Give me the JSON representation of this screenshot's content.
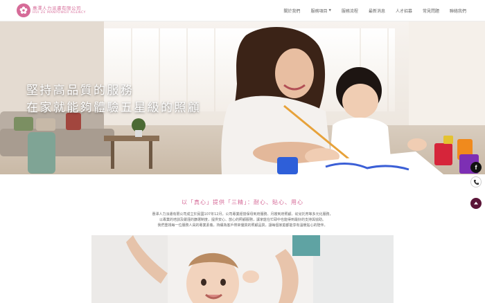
{
  "header": {
    "company_name": "惠澤人力派遣有限公司",
    "company_sub": "HUI ZE MANPOWER AGENCY",
    "logo_icon": "flower-logo-icon",
    "nav": [
      {
        "label": "關於我們",
        "dropdown": false
      },
      {
        "label": "服務項目",
        "dropdown": true
      },
      {
        "label": "服務流程",
        "dropdown": false
      },
      {
        "label": "最新消息",
        "dropdown": false
      },
      {
        "label": "人才招募",
        "dropdown": false
      },
      {
        "label": "常見問題",
        "dropdown": false
      },
      {
        "label": "聯絡我們",
        "dropdown": false
      }
    ]
  },
  "hero": {
    "line1": "堅持高品質的服務",
    "line2": "在家就能夠體驗五星級的照顧"
  },
  "side_buttons": {
    "facebook_label": "f",
    "icons": [
      "facebook-icon",
      "phone-icon",
      "arrow-up-icon"
    ]
  },
  "intro": {
    "slogan": "以「真心」提供「三精」：耐心、貼心、用心",
    "paragraphs": [
      "惠澤人力派遣有限公司成立於民國107年12月，公司專業經營保母到府服務、月嫂到府照顧、幼兒托育等多元化服務，",
      "以專業的培訓及嚴謹的篩選制度，提供安心、放心的照顧服務，讓家庭在忙碌中也能得到最好的支持與協助。",
      "我們重視每一位服務人員的專業素養，持續為客戶帶來優質的照顧品質，讓每個家庭都能享有溫暖貼心的陪伴。"
    ]
  },
  "colors": {
    "brand_pink": "#d66b98",
    "scroll_top_bg": "#5b1538"
  }
}
